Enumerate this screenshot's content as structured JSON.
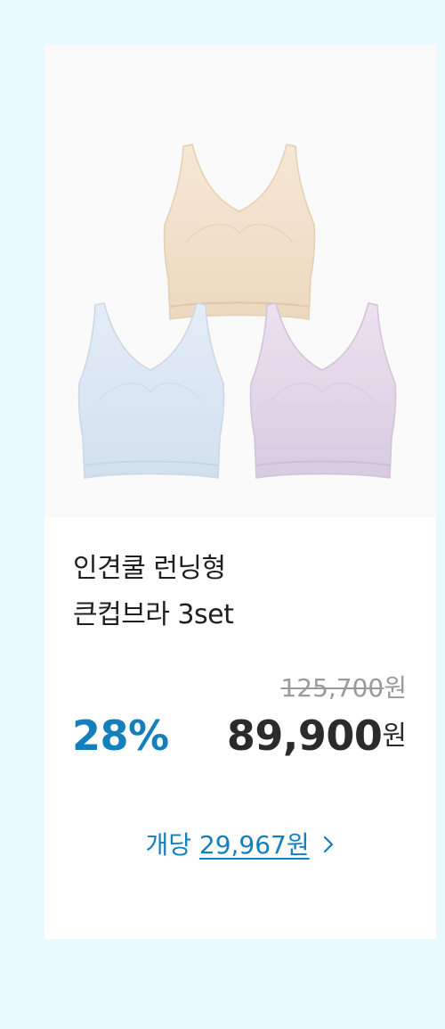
{
  "product": {
    "title_line1": "인견쿨 런닝형",
    "title_line2": "큰컵브라 3set",
    "original_price": "125,700",
    "original_price_unit": "원",
    "discount": "28%",
    "sale_price": "89,900",
    "sale_price_unit": "원",
    "per_unit_label": "개당",
    "per_unit_price": "29,967원",
    "image_colors": {
      "beige": "#f3e2cc",
      "blue": "#dde8f3",
      "lavender": "#e4d8e9"
    }
  },
  "colors": {
    "background": "#e9f9ff",
    "accent": "#137fbd",
    "text": "#1f1f1f",
    "muted": "#9a9a9a"
  }
}
